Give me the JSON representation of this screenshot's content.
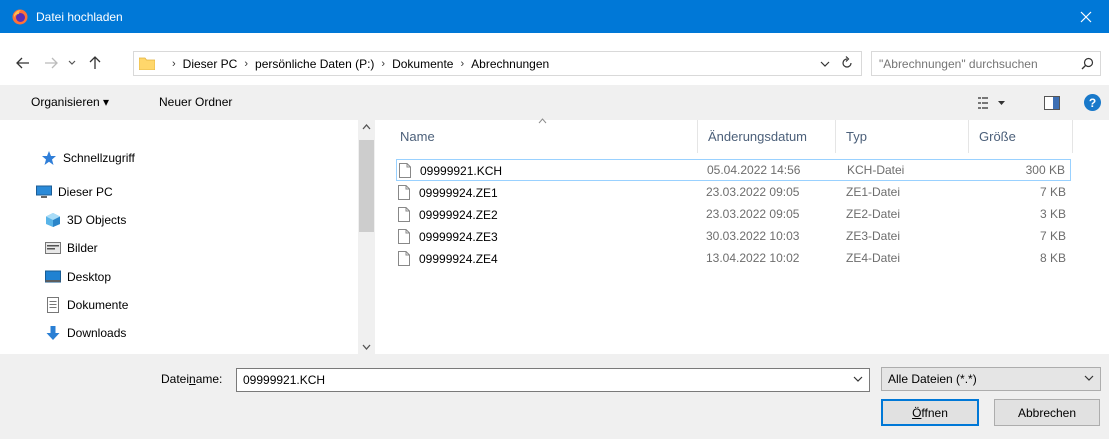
{
  "window": {
    "title": "Datei hochladen",
    "accent_color": "#0078d7"
  },
  "address": {
    "breadcrumbs": [
      "Dieser PC",
      "persönliche Daten (P:)",
      "Dokumente",
      "Abrechnungen"
    ],
    "search_placeholder": "\"Abrechnungen\" durchsuchen"
  },
  "toolbar": {
    "organize_label": "Organisieren ▾",
    "new_folder_label": "Neuer Ordner",
    "help_label": "?"
  },
  "nav": {
    "items": [
      {
        "label": "Schnellzugriff",
        "icon": "star-icon"
      },
      {
        "label": "Dieser PC",
        "icon": "computer-icon"
      },
      {
        "label": "3D Objects",
        "icon": "cube-icon"
      },
      {
        "label": "Bilder",
        "icon": "pictures-icon"
      },
      {
        "label": "Desktop",
        "icon": "desktop-icon"
      },
      {
        "label": "Dokumente",
        "icon": "documents-icon"
      },
      {
        "label": "Downloads",
        "icon": "download-icon"
      }
    ]
  },
  "files": {
    "columns": [
      "Name",
      "Änderungsdatum",
      "Typ",
      "Größe"
    ],
    "rows": [
      {
        "name": "09999921.KCH",
        "date": "05.04.2022 14:56",
        "type": "KCH-Datei",
        "size": "300 KB",
        "selected": true
      },
      {
        "name": "09999924.ZE1",
        "date": "23.03.2022 09:05",
        "type": "ZE1-Datei",
        "size": "7 KB",
        "selected": false
      },
      {
        "name": "09999924.ZE2",
        "date": "23.03.2022 09:05",
        "type": "ZE2-Datei",
        "size": "3 KB",
        "selected": false
      },
      {
        "name": "09999924.ZE3",
        "date": "30.03.2022 10:03",
        "type": "ZE3-Datei",
        "size": "7 KB",
        "selected": false
      },
      {
        "name": "09999924.ZE4",
        "date": "13.04.2022 10:02",
        "type": "ZE4-Datei",
        "size": "8 KB",
        "selected": false
      }
    ]
  },
  "footer": {
    "filename_label_pre": "Datei",
    "filename_label_u": "n",
    "filename_label_post": "ame:",
    "filename_value": "09999921.KCH",
    "filter_value": "Alle Dateien (*.*)",
    "open_label_u": "Ö",
    "open_label_rest": "ffnen",
    "cancel_label": "Abbrechen"
  }
}
